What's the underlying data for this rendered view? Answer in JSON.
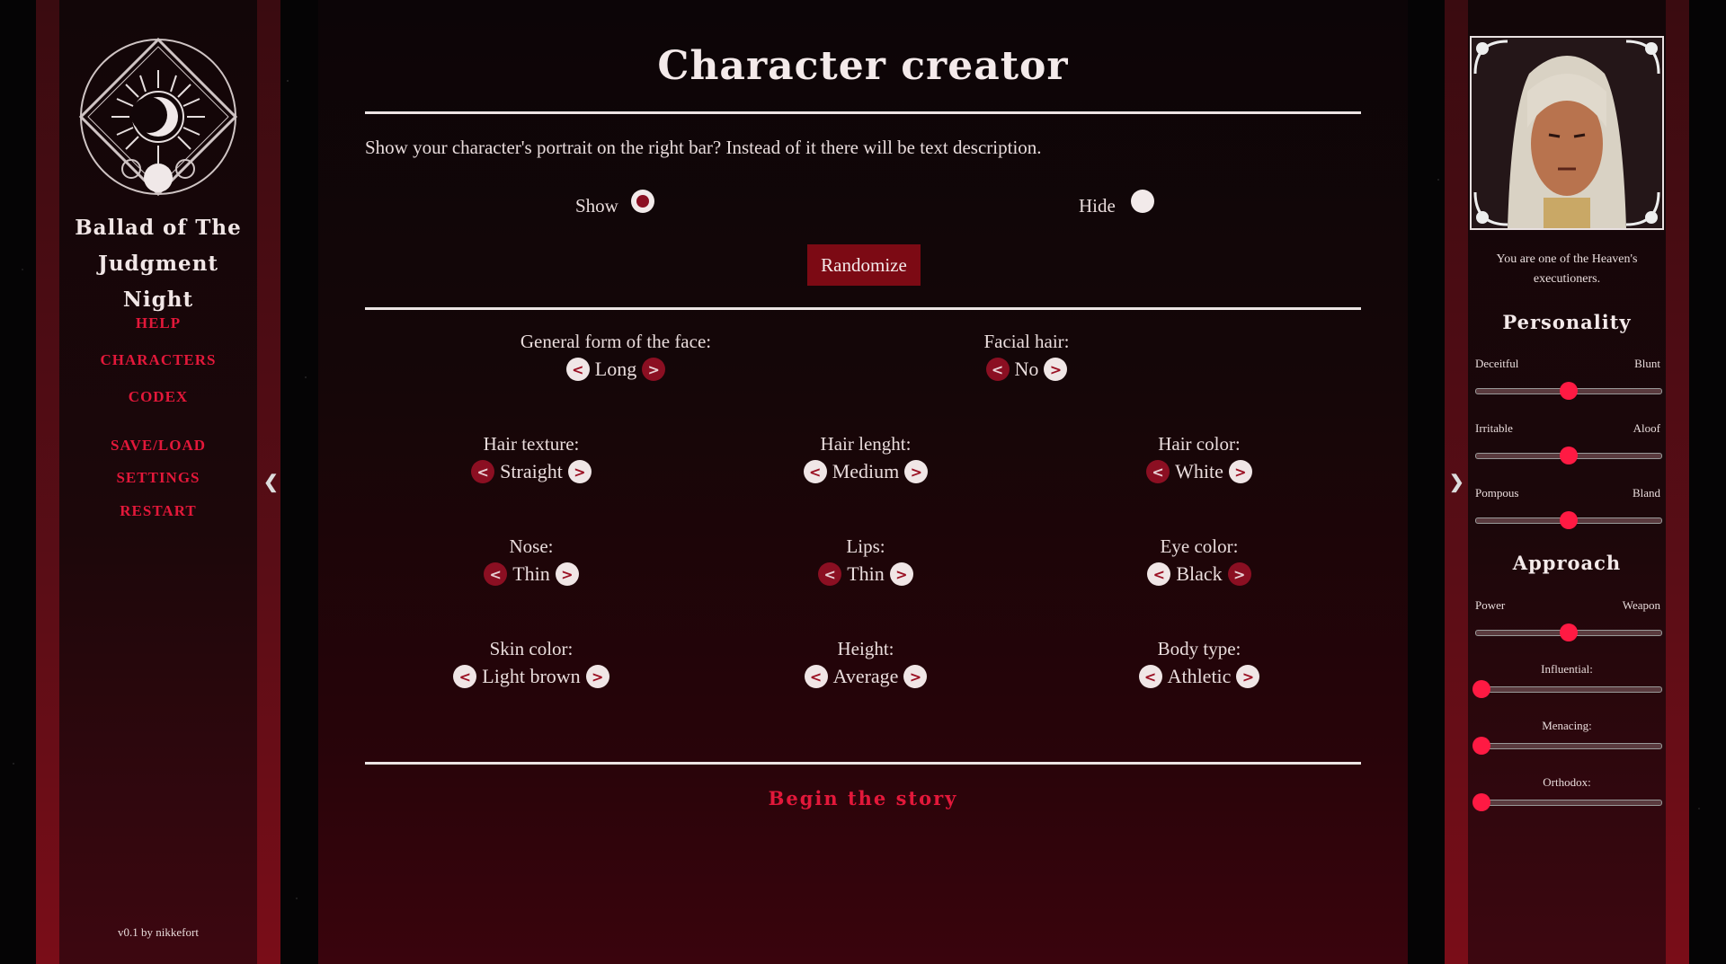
{
  "game": {
    "title_line1": "Ballad of The",
    "title_line2": "Judgment Night",
    "version": "v0.1 by nikkefort"
  },
  "nav": [
    "HELP",
    "CHARACTERS",
    "CODEX",
    "SAVE/LOAD",
    "SETTINGS",
    "RESTART"
  ],
  "main": {
    "title": "Character creator",
    "question": "Show your character's portrait on the right bar? Instead of it there will be text description.",
    "show_label": "Show",
    "hide_label": "Hide",
    "selected_option": "Show",
    "randomize_label": "Randomize",
    "begin_label": "Begin the story",
    "options": [
      {
        "label": "General form of the face:",
        "value": "Long"
      },
      {
        "label": "Facial hair:",
        "value": "No"
      },
      {
        "label": "Hair texture:",
        "value": "Straight"
      },
      {
        "label": "Hair lenght:",
        "value": "Medium"
      },
      {
        "label": "Hair color:",
        "value": "White"
      },
      {
        "label": "Nose:",
        "value": "Thin"
      },
      {
        "label": "Lips:",
        "value": "Thin"
      },
      {
        "label": "Eye color:",
        "value": "Black"
      },
      {
        "label": "Skin color:",
        "value": "Light brown"
      },
      {
        "label": "Height:",
        "value": "Average"
      },
      {
        "label": "Body type:",
        "value": "Athletic"
      }
    ]
  },
  "sidebar": {
    "description": "You are one of the Heaven's executioners.",
    "personality_title": "Personality",
    "approach_title": "Approach",
    "personality": [
      {
        "left": "Deceitful",
        "right": "Blunt",
        "value": 0.5
      },
      {
        "left": "Irritable",
        "right": "Aloof",
        "value": 0.5
      },
      {
        "left": "Pompous",
        "right": "Bland",
        "value": 0.5
      }
    ],
    "approach_pair": {
      "left": "Power",
      "right": "Weapon",
      "value": 0.5
    },
    "approach": [
      {
        "label": "Influential:",
        "value": 0
      },
      {
        "label": "Menacing:",
        "value": 0
      },
      {
        "label": "Orthodox:",
        "value": 0
      }
    ]
  },
  "colors": {
    "accent": "#e3183a",
    "button": "#7c0a14",
    "thumb": "#ff1a43"
  }
}
